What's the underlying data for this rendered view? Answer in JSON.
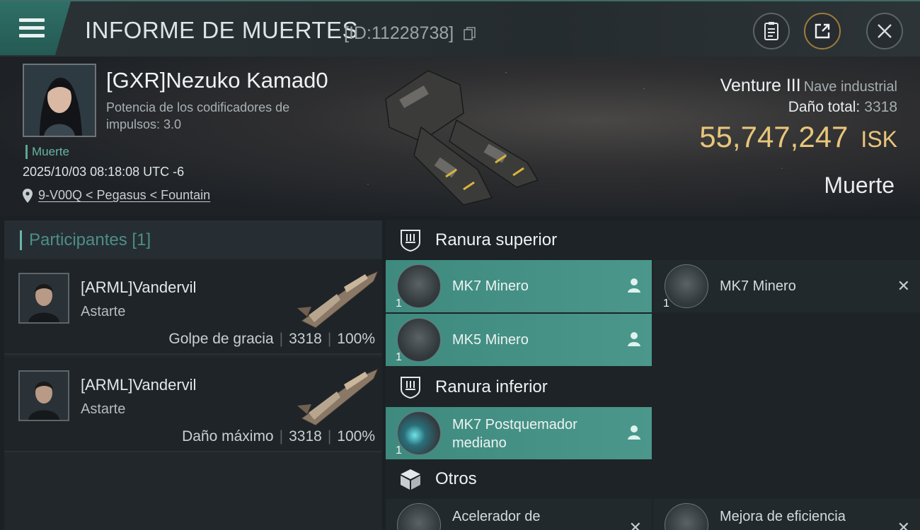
{
  "header": {
    "title": "INFORME DE MUERTES",
    "report_id": "[ID:11228738]",
    "menu_icon": "hamburger-menu-icon",
    "buttons": [
      {
        "icon": "clipboard-icon"
      },
      {
        "icon": "share-export-icon"
      },
      {
        "icon": "close-icon"
      }
    ]
  },
  "victim": {
    "name": "[GXR]Nezuko Kamad0",
    "attribute": "Potencia de los codificadores de impulsos: 3.0",
    "loss_tag": "Muerte",
    "datetime": "2025/10/03 08:18:08 UTC -6",
    "location": "9-V00Q < Pegasus < Fountain",
    "ship_name": "Venture III",
    "ship_class": "Nave industrial",
    "total_damage_label": "Daño total:",
    "total_damage": "3318",
    "isk_value": "55,747,247",
    "isk_currency": "ISK",
    "outcome": "Muerte"
  },
  "participants": {
    "title": "Participantes",
    "count": "[1]",
    "rows": [
      {
        "name": "[ARML]Vandervil",
        "ship": "Astarte",
        "role": "Golpe de gracia",
        "damage": "3318",
        "percent": "100%"
      },
      {
        "name": "[ARML]Vandervil",
        "ship": "Astarte",
        "role": "Daño máximo",
        "damage": "3318",
        "percent": "100%"
      }
    ]
  },
  "fitting": {
    "high_slot_title": "Ranura superior",
    "low_slot_title": "Ranura inferior",
    "other_title": "Otros",
    "high_modules": [
      {
        "name": "MK7 Minero",
        "qty": "1",
        "state": "fitted"
      },
      {
        "name": "MK7 Minero",
        "qty": "1",
        "state": "dropped"
      },
      {
        "name": "MK5 Minero",
        "qty": "1",
        "state": "fitted"
      }
    ],
    "low_modules": [
      {
        "name_line1": "MK7 Postquemador",
        "name_line2": "mediano",
        "qty": "1",
        "state": "fitted"
      }
    ],
    "other_modules": [
      {
        "name": "Acelerador de",
        "state": "dropped"
      },
      {
        "name": "Mejora de eficiencia",
        "state": "dropped"
      }
    ]
  },
  "colors": {
    "accent_teal": "#4b978b",
    "isk_gold": "#e8c67a",
    "loss_tag": "#68b3a6"
  }
}
